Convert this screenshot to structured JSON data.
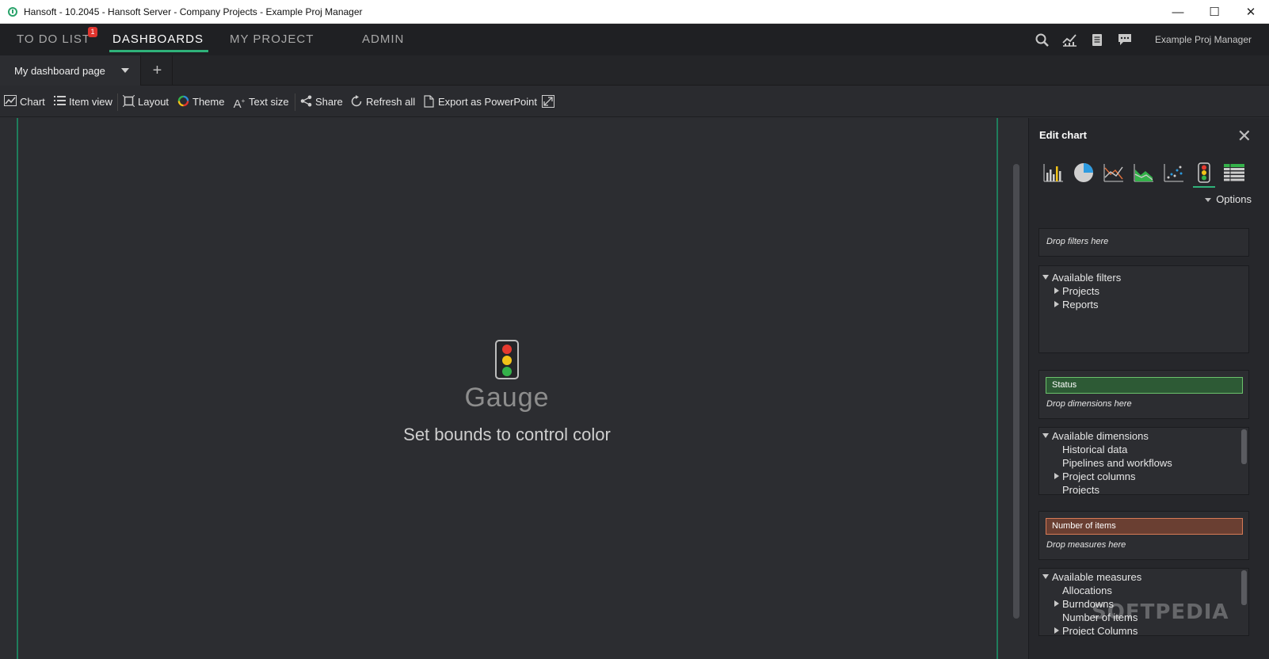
{
  "window": {
    "title": "Hansoft - 10.2045 - Hansoft Server - Company Projects - Example Proj Manager",
    "minimize": "—",
    "maximize": "☐",
    "close": "✕"
  },
  "nav": {
    "tabs": [
      {
        "label": "TO DO LIST",
        "badge": "1"
      },
      {
        "label": "DASHBOARDS"
      },
      {
        "label": "MY PROJECT"
      },
      {
        "label": "ADMIN"
      }
    ],
    "user": "Example Proj Manager",
    "icons": [
      "search-icon",
      "analytics-icon",
      "document-icon",
      "chat-icon"
    ]
  },
  "pagebar": {
    "page_name": "My dashboard page",
    "add_label": "+"
  },
  "toolbar": {
    "chart": "Chart",
    "item_view": "Item view",
    "layout": "Layout",
    "theme": "Theme",
    "text_size": "Text size",
    "share": "Share",
    "refresh_all": "Refresh all",
    "export": "Export as PowerPoint"
  },
  "canvas": {
    "gauge_title": "Gauge",
    "gauge_subtitle": "Set bounds to control color",
    "traffic_colors": [
      "#e53a2f",
      "#f3c318",
      "#34b24a"
    ]
  },
  "panel": {
    "title": "Edit chart",
    "close": "✕",
    "options": "Options",
    "chart_types": [
      "bar-chart-icon",
      "pie-chart-icon",
      "line-chart-icon",
      "area-chart-icon",
      "scatter-chart-icon",
      "gauge-chart-icon",
      "table-chart-icon"
    ],
    "drop_filters": "Drop filters here",
    "available_filters": {
      "label": "Available filters",
      "items": [
        "Projects",
        "Reports"
      ]
    },
    "dimension_chip": "Status",
    "drop_dimensions": "Drop dimensions here",
    "available_dimensions": {
      "label": "Available dimensions",
      "items": [
        "Historical data",
        "Pipelines and workflows",
        "Project columns",
        "Projects"
      ]
    },
    "measure_chip": "Number of items",
    "drop_measures": "Drop measures here",
    "available_measures": {
      "label": "Available measures",
      "items": [
        "Allocations",
        "Burndowns",
        "Number of items",
        "Project Columns"
      ]
    }
  },
  "colors": {
    "accent": "#2fb27a",
    "status_chip": "#2d5a35",
    "measure_chip": "#6a3f32"
  },
  "watermark": "SOFTPEDIA"
}
